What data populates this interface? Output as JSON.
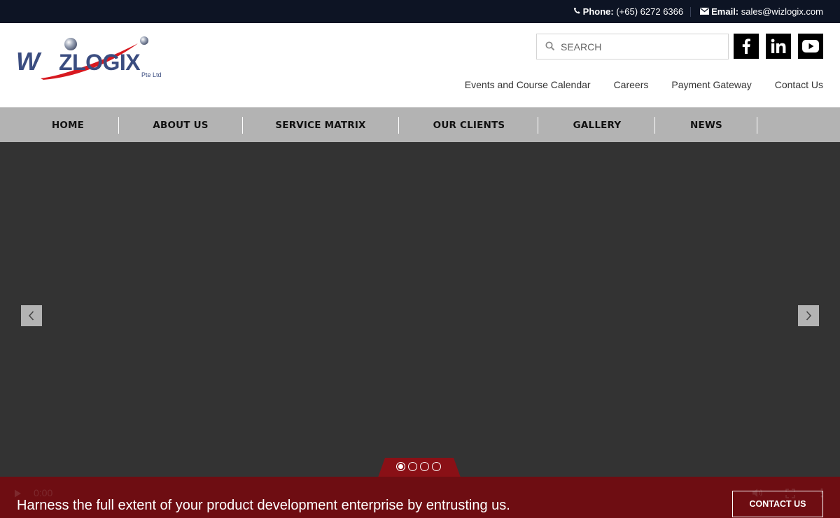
{
  "topbar": {
    "phone_label": "Phone:",
    "phone_value": "(+65) 6272 6366",
    "email_label": "Email:",
    "email_value": "sales@wizlogix.com",
    "phone_icon": "phone-icon",
    "email_icon": "envelope-icon"
  },
  "logo": {
    "text": "WIZLOGIX",
    "subtext": "Pte Ltd",
    "colors": {
      "navy": "#3b4d80",
      "red": "#d71920",
      "silver": "#9aa3b5"
    }
  },
  "search": {
    "placeholder": "SEARCH"
  },
  "social": [
    "facebook-icon",
    "linkedin-icon",
    "youtube-icon"
  ],
  "sub_nav": [
    "Events and Course Calendar",
    "Careers",
    "Payment Gateway",
    "Contact Us"
  ],
  "main_nav": [
    "HOME",
    "ABOUT US",
    "SERVICE MATRIX",
    "OUR CLIENTS",
    "GALLERY",
    "NEWS"
  ],
  "slider": {
    "dots": 4,
    "active_dot": 0,
    "video_time": "0:00",
    "tagline": "Harness the full extent of your product development enterprise by entrusting us.",
    "cta_label": "CONTACT US"
  },
  "colors": {
    "topbar_bg": "#0d1424",
    "nav_bg": "#b3b3b3",
    "hero_bg": "#333333",
    "banner_bg": "#6e0d12"
  }
}
